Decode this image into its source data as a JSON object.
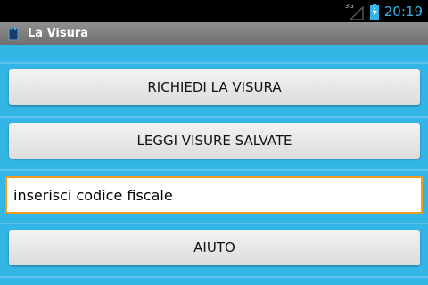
{
  "status_bar": {
    "network_type": "3G",
    "time": "20:19"
  },
  "action_bar": {
    "title": "La Visura",
    "icon": "app-icon"
  },
  "buttons": {
    "request": "RICHIEDI LA VISURA",
    "saved": "LEGGI VISURE SALVATE",
    "help": "AIUTO"
  },
  "codice_fiscale_input": {
    "value": "inserisci codice fiscale"
  },
  "colors": {
    "background": "#33b5e5",
    "input_focus_border": "#f29b1e",
    "status_accent": "#33b5e5"
  }
}
